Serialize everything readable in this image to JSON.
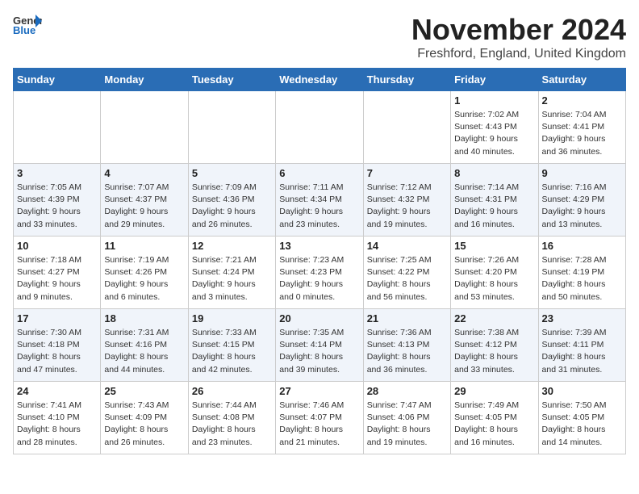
{
  "header": {
    "logo_general": "General",
    "logo_blue": "Blue",
    "month_title": "November 2024",
    "location": "Freshford, England, United Kingdom"
  },
  "weekdays": [
    "Sunday",
    "Monday",
    "Tuesday",
    "Wednesday",
    "Thursday",
    "Friday",
    "Saturday"
  ],
  "weeks": [
    [
      {
        "day": "",
        "info": ""
      },
      {
        "day": "",
        "info": ""
      },
      {
        "day": "",
        "info": ""
      },
      {
        "day": "",
        "info": ""
      },
      {
        "day": "",
        "info": ""
      },
      {
        "day": "1",
        "info": "Sunrise: 7:02 AM\nSunset: 4:43 PM\nDaylight: 9 hours\nand 40 minutes."
      },
      {
        "day": "2",
        "info": "Sunrise: 7:04 AM\nSunset: 4:41 PM\nDaylight: 9 hours\nand 36 minutes."
      }
    ],
    [
      {
        "day": "3",
        "info": "Sunrise: 7:05 AM\nSunset: 4:39 PM\nDaylight: 9 hours\nand 33 minutes."
      },
      {
        "day": "4",
        "info": "Sunrise: 7:07 AM\nSunset: 4:37 PM\nDaylight: 9 hours\nand 29 minutes."
      },
      {
        "day": "5",
        "info": "Sunrise: 7:09 AM\nSunset: 4:36 PM\nDaylight: 9 hours\nand 26 minutes."
      },
      {
        "day": "6",
        "info": "Sunrise: 7:11 AM\nSunset: 4:34 PM\nDaylight: 9 hours\nand 23 minutes."
      },
      {
        "day": "7",
        "info": "Sunrise: 7:12 AM\nSunset: 4:32 PM\nDaylight: 9 hours\nand 19 minutes."
      },
      {
        "day": "8",
        "info": "Sunrise: 7:14 AM\nSunset: 4:31 PM\nDaylight: 9 hours\nand 16 minutes."
      },
      {
        "day": "9",
        "info": "Sunrise: 7:16 AM\nSunset: 4:29 PM\nDaylight: 9 hours\nand 13 minutes."
      }
    ],
    [
      {
        "day": "10",
        "info": "Sunrise: 7:18 AM\nSunset: 4:27 PM\nDaylight: 9 hours\nand 9 minutes."
      },
      {
        "day": "11",
        "info": "Sunrise: 7:19 AM\nSunset: 4:26 PM\nDaylight: 9 hours\nand 6 minutes."
      },
      {
        "day": "12",
        "info": "Sunrise: 7:21 AM\nSunset: 4:24 PM\nDaylight: 9 hours\nand 3 minutes."
      },
      {
        "day": "13",
        "info": "Sunrise: 7:23 AM\nSunset: 4:23 PM\nDaylight: 9 hours\nand 0 minutes."
      },
      {
        "day": "14",
        "info": "Sunrise: 7:25 AM\nSunset: 4:22 PM\nDaylight: 8 hours\nand 56 minutes."
      },
      {
        "day": "15",
        "info": "Sunrise: 7:26 AM\nSunset: 4:20 PM\nDaylight: 8 hours\nand 53 minutes."
      },
      {
        "day": "16",
        "info": "Sunrise: 7:28 AM\nSunset: 4:19 PM\nDaylight: 8 hours\nand 50 minutes."
      }
    ],
    [
      {
        "day": "17",
        "info": "Sunrise: 7:30 AM\nSunset: 4:18 PM\nDaylight: 8 hours\nand 47 minutes."
      },
      {
        "day": "18",
        "info": "Sunrise: 7:31 AM\nSunset: 4:16 PM\nDaylight: 8 hours\nand 44 minutes."
      },
      {
        "day": "19",
        "info": "Sunrise: 7:33 AM\nSunset: 4:15 PM\nDaylight: 8 hours\nand 42 minutes."
      },
      {
        "day": "20",
        "info": "Sunrise: 7:35 AM\nSunset: 4:14 PM\nDaylight: 8 hours\nand 39 minutes."
      },
      {
        "day": "21",
        "info": "Sunrise: 7:36 AM\nSunset: 4:13 PM\nDaylight: 8 hours\nand 36 minutes."
      },
      {
        "day": "22",
        "info": "Sunrise: 7:38 AM\nSunset: 4:12 PM\nDaylight: 8 hours\nand 33 minutes."
      },
      {
        "day": "23",
        "info": "Sunrise: 7:39 AM\nSunset: 4:11 PM\nDaylight: 8 hours\nand 31 minutes."
      }
    ],
    [
      {
        "day": "24",
        "info": "Sunrise: 7:41 AM\nSunset: 4:10 PM\nDaylight: 8 hours\nand 28 minutes."
      },
      {
        "day": "25",
        "info": "Sunrise: 7:43 AM\nSunset: 4:09 PM\nDaylight: 8 hours\nand 26 minutes."
      },
      {
        "day": "26",
        "info": "Sunrise: 7:44 AM\nSunset: 4:08 PM\nDaylight: 8 hours\nand 23 minutes."
      },
      {
        "day": "27",
        "info": "Sunrise: 7:46 AM\nSunset: 4:07 PM\nDaylight: 8 hours\nand 21 minutes."
      },
      {
        "day": "28",
        "info": "Sunrise: 7:47 AM\nSunset: 4:06 PM\nDaylight: 8 hours\nand 19 minutes."
      },
      {
        "day": "29",
        "info": "Sunrise: 7:49 AM\nSunset: 4:05 PM\nDaylight: 8 hours\nand 16 minutes."
      },
      {
        "day": "30",
        "info": "Sunrise: 7:50 AM\nSunset: 4:05 PM\nDaylight: 8 hours\nand 14 minutes."
      }
    ]
  ]
}
